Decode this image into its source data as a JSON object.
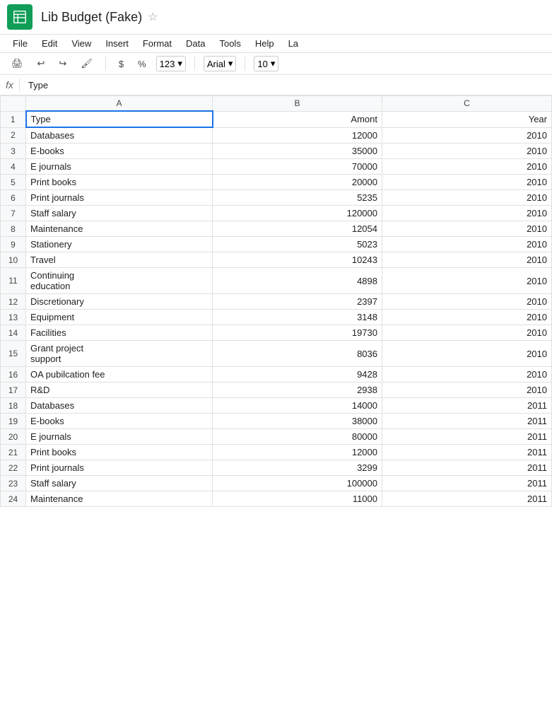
{
  "app": {
    "icon_label": "spreadsheet-icon",
    "title": "Lib Budget (Fake)",
    "star_char": "☆"
  },
  "menu": {
    "items": [
      "File",
      "Edit",
      "View",
      "Insert",
      "Format",
      "Data",
      "Tools",
      "Help",
      "La"
    ]
  },
  "toolbar": {
    "print_icon": "🖨",
    "undo_icon": "↩",
    "redo_icon": "↪",
    "paint_icon": "🖌",
    "dollar": "$",
    "percent": "%",
    "num_format": "123",
    "font": "Arial",
    "font_size": "10"
  },
  "formula_bar": {
    "fx": "fx",
    "cell_ref": "",
    "content": "Type"
  },
  "columns": {
    "row_num": "",
    "a": "A",
    "b": "B",
    "c": "C"
  },
  "rows": [
    {
      "num": "1",
      "a": "Type",
      "b": "Amont",
      "c": "Year",
      "header": true,
      "selected_a": true
    },
    {
      "num": "2",
      "a": "Databases",
      "b": "12000",
      "c": "2010"
    },
    {
      "num": "3",
      "a": "E-books",
      "b": "35000",
      "c": "2010"
    },
    {
      "num": "4",
      "a": "E journals",
      "b": "70000",
      "c": "2010"
    },
    {
      "num": "5",
      "a": "Print books",
      "b": "20000",
      "c": "2010"
    },
    {
      "num": "6",
      "a": "Print journals",
      "b": "5235",
      "c": "2010"
    },
    {
      "num": "7",
      "a": "Staff salary",
      "b": "120000",
      "c": "2010"
    },
    {
      "num": "8",
      "a": "Maintenance",
      "b": "12054",
      "c": "2010"
    },
    {
      "num": "9",
      "a": "Stationery",
      "b": "5023",
      "c": "2010"
    },
    {
      "num": "10",
      "a": "Travel",
      "b": "10243",
      "c": "2010"
    },
    {
      "num": "11",
      "a": "Continuing\neducation",
      "b": "4898",
      "c": "2010",
      "multiline": true
    },
    {
      "num": "12",
      "a": "Discretionary",
      "b": "2397",
      "c": "2010"
    },
    {
      "num": "13",
      "a": "Equipment",
      "b": "3148",
      "c": "2010"
    },
    {
      "num": "14",
      "a": "Facilities",
      "b": "19730",
      "c": "2010"
    },
    {
      "num": "15",
      "a": "Grant project\nsupport",
      "b": "8036",
      "c": "2010",
      "multiline": true
    },
    {
      "num": "16",
      "a": "OA pubilcation fee",
      "b": "9428",
      "c": "2010"
    },
    {
      "num": "17",
      "a": "R&D",
      "b": "2938",
      "c": "2010"
    },
    {
      "num": "18",
      "a": "Databases",
      "b": "14000",
      "c": "2011"
    },
    {
      "num": "19",
      "a": "E-books",
      "b": "38000",
      "c": "2011"
    },
    {
      "num": "20",
      "a": "E journals",
      "b": "80000",
      "c": "2011"
    },
    {
      "num": "21",
      "a": "Print books",
      "b": "12000",
      "c": "2011"
    },
    {
      "num": "22",
      "a": "Print journals",
      "b": "3299",
      "c": "2011"
    },
    {
      "num": "23",
      "a": "Staff salary",
      "b": "100000",
      "c": "2011"
    },
    {
      "num": "24",
      "a": "Maintenance",
      "b": "11000",
      "c": "2011"
    }
  ]
}
